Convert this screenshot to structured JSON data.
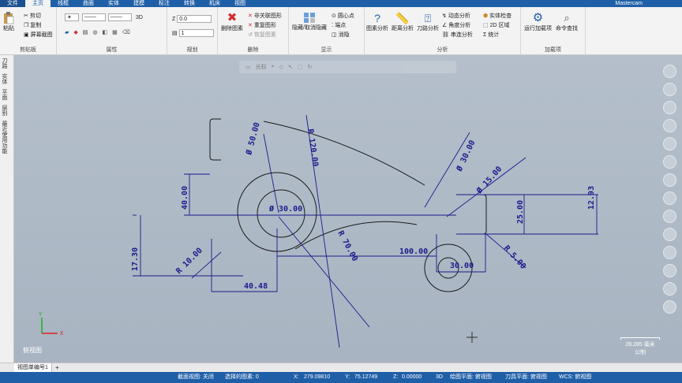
{
  "tabs": [
    "文件",
    "主页",
    "线框",
    "曲面",
    "实体",
    "建模",
    "标注",
    "转换",
    "机床",
    "视图"
  ],
  "brand": "Mastercam",
  "ribbon": {
    "clipboard": {
      "paste": "粘贴",
      "cut": "剪切",
      "copy": "复制",
      "screenshot": "屏幕截图",
      "label": "剪贴板"
    },
    "attributes": {
      "mode_3d": "3D",
      "label": "属性"
    },
    "organize": {
      "z_label": "Z",
      "z_value": "0.0",
      "level_value": "1",
      "label": "规划"
    },
    "delete": {
      "delete_entities": "删除图素",
      "unrelated": "非关联图形",
      "redo": "重复图形",
      "restore": "恢复图素",
      "label": "删除"
    },
    "display": {
      "hide": "隐藏/取消隐藏",
      "center": "圆心点",
      "endpoints": "端点",
      "blank": "消隐",
      "label": "显示"
    },
    "analysis": {
      "entity": "图素分析",
      "distance": "距离分析",
      "toolpath": "刀路分析",
      "dynamic": "动态分析",
      "angle": "角度分析",
      "chain": "串连分析",
      "check": "实体检查",
      "region": "2D 区域",
      "stats": "统计",
      "label": "分析"
    },
    "addins": {
      "run": "运行加载项",
      "command": "命令查找",
      "label": "加载项"
    }
  },
  "sidebar_tabs": [
    "刀路",
    "实体",
    "平面",
    "层别",
    "最近使用功能"
  ],
  "floatbar_label": "光标",
  "drawing": {
    "dims": [
      "Ø 50.00",
      "R 120.00",
      "Ø 30.00",
      "Ø 15.00",
      "Ø 30.00",
      "40.00",
      "17.30",
      "R 10.00",
      "40.48",
      "R 70.00",
      "100.00",
      "30.00",
      "R 5.00",
      "25.00",
      "12.93"
    ]
  },
  "view_name": "俯视图",
  "scale": {
    "value": "28.285 毫米",
    "unit": "公制"
  },
  "viewsheet": "视图单编号1",
  "status": {
    "section": "截面视图: 关闭",
    "selected": "选择的图素: 0",
    "x_label": "X:",
    "x": "279.09810",
    "y_label": "Y:",
    "y": "75.12749",
    "z_label": "Z:",
    "z": "0.00000",
    "mode": "3D",
    "gplane": "绘图平面: 俯视图",
    "tplane": "刀具平面: 俯视图",
    "wcs": "WCS: 俯视图"
  },
  "colors": {
    "accent": "#1f5fa8",
    "dim": "#1b1b8c",
    "geometry": "#1a1a1a"
  }
}
